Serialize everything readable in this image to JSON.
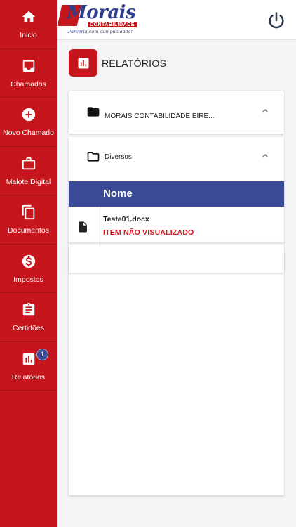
{
  "sidebar": {
    "items": [
      {
        "label": "Inicio",
        "icon": "home-icon"
      },
      {
        "label": "Chamados",
        "icon": "inbox-icon"
      },
      {
        "label": "Novo Chamado",
        "icon": "add-circle-icon"
      },
      {
        "label": "Malote Digital",
        "icon": "briefcase-icon"
      },
      {
        "label": "Documentos",
        "icon": "documents-icon"
      },
      {
        "label": "Impostos",
        "icon": "dollar-icon"
      },
      {
        "label": "Certidões",
        "icon": "clipboard-icon"
      },
      {
        "label": "Relatórios",
        "icon": "bar-chart-icon",
        "badge": "1"
      }
    ]
  },
  "header": {
    "logo": {
      "text": "Morais",
      "sub": "CONTABILIDADE",
      "tagline": "Parceria com cumplicidade!"
    },
    "power_icon": "power-icon"
  },
  "page": {
    "title": "RELATÓRIOS",
    "company_folder": "MORAIS CONTABILIDADE EIRE...",
    "subfolder": "Diversos",
    "table": {
      "header": "Nome",
      "rows": [
        {
          "name": "Teste01.docx",
          "status": "ITEM NÃO VISUALIZADO"
        }
      ]
    }
  },
  "colors": {
    "brand_red": "#c4161c",
    "brand_blue": "#3a4a96",
    "status_red": "#d6141b"
  }
}
